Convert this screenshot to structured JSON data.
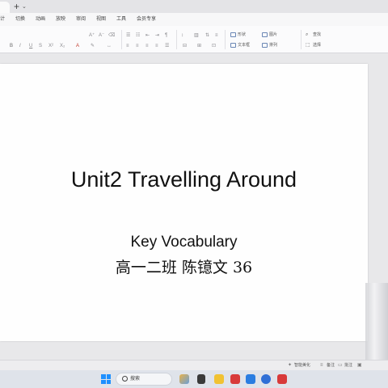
{
  "tabstrip": {
    "add_glyph": "+",
    "more_glyph": "⌄"
  },
  "ribbon_tabs": [
    "计",
    "切换",
    "动画",
    "放映",
    "审阅",
    "视图",
    "工具",
    "会员专享"
  ],
  "ribbon": {
    "right_items": [
      "形状",
      "图片",
      "查找",
      "文本框",
      "排列",
      "选择"
    ]
  },
  "slide": {
    "title": "Unit2 Travelling Around",
    "subtitle": "Key Vocabulary",
    "name_line": "高一二班 陈镱文 36"
  },
  "statusbar": {
    "smart_beautify": "智能美化",
    "notes": "备注",
    "comments": "批注"
  },
  "taskbar": {
    "search_label": "搜索"
  },
  "colors": {
    "win_blue": "#1e90ff",
    "accent_red": "#d83a3a"
  }
}
